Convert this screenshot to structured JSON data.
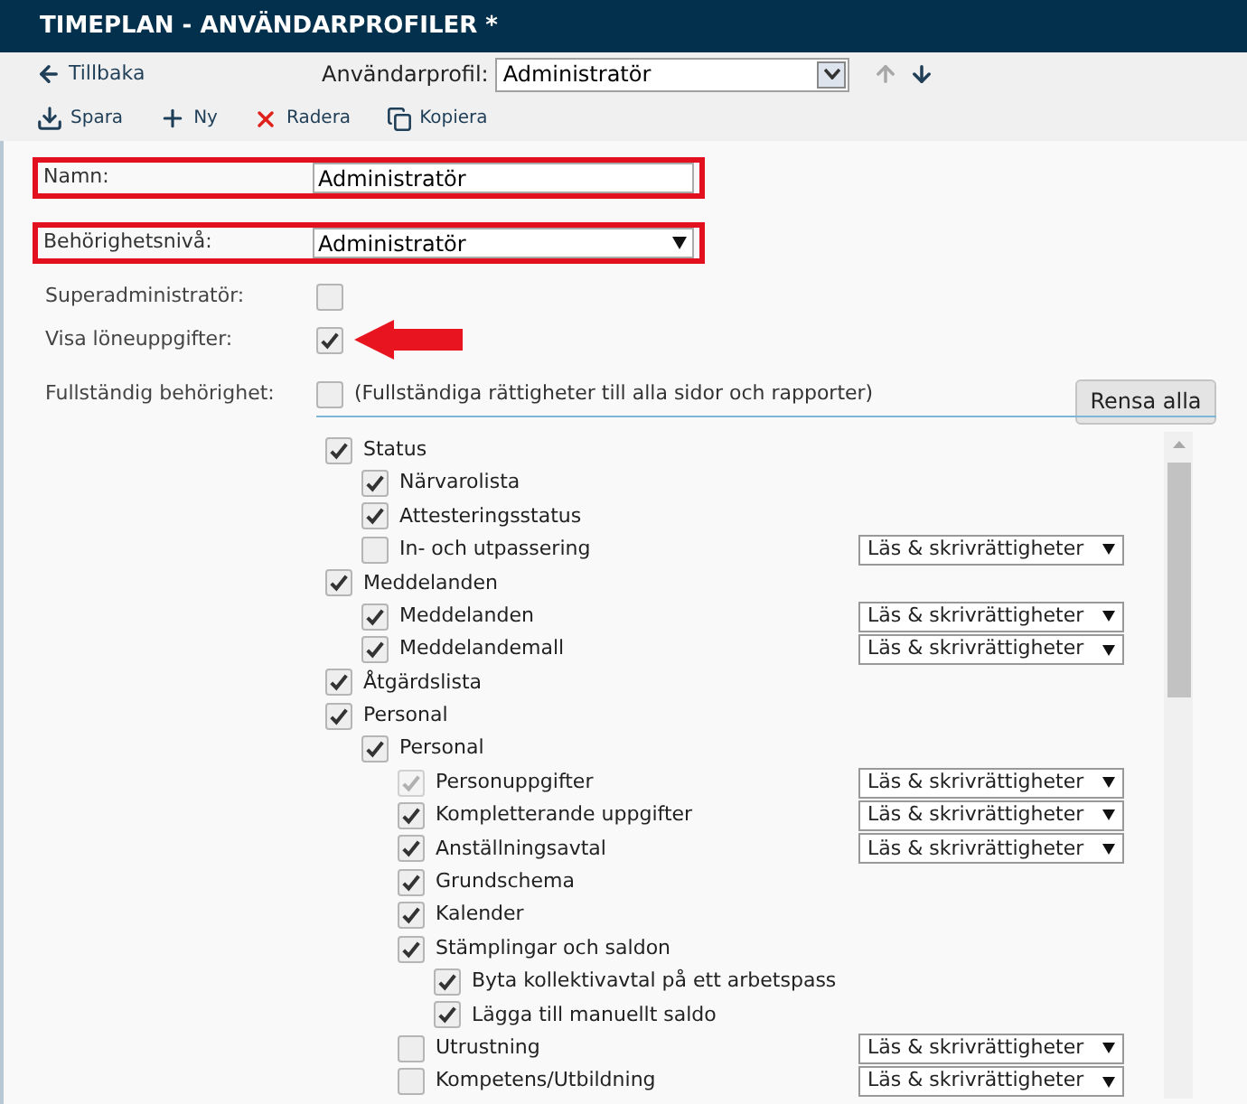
{
  "window": {
    "title": "TIMEPLAN - ANVÄNDARPROFILER *"
  },
  "nav": {
    "back": "Tillbaka",
    "profile_label": "Användarprofil:",
    "profile_value": "Administratör",
    "move_up_disabled": true,
    "move_down_disabled": false
  },
  "toolbar": [
    {
      "kind": "save",
      "label": "Spara"
    },
    {
      "kind": "new",
      "label": "Ny"
    },
    {
      "kind": "delete",
      "label": "Radera"
    },
    {
      "kind": "copy",
      "label": "Kopiera"
    }
  ],
  "form": {
    "name": {
      "label": "Namn:",
      "value": "Administratör",
      "highlighted": true
    },
    "level": {
      "label": "Behörighetsnivå:",
      "value": "Administratör",
      "highlighted": true
    },
    "superadmin": {
      "label": "Superadministratör:",
      "checked": false,
      "pointer_arrow": false
    },
    "show_salary": {
      "label": "Visa löneuppgifter:",
      "checked": true,
      "pointer_arrow": true
    },
    "full_access": {
      "label": "Fullständig behörighet:",
      "checked": false,
      "note": "(Fullständiga rättigheter till alla sidor och rapporter)"
    },
    "clear_button": "Rensa alla"
  },
  "tree": [
    {
      "label": "Status",
      "checked": true,
      "disabled": false,
      "children": [
        {
          "label": "Närvarolista",
          "checked": true,
          "disabled": false
        },
        {
          "label": "Attesteringsstatus",
          "checked": true,
          "disabled": false
        },
        {
          "label": "In- och utpassering",
          "checked": false,
          "disabled": false,
          "permission": "Läs & skrivrättigheter"
        }
      ]
    },
    {
      "label": "Meddelanden",
      "checked": true,
      "disabled": false,
      "children": [
        {
          "label": "Meddelanden",
          "checked": true,
          "disabled": false,
          "permission": "Läs & skrivrättigheter"
        },
        {
          "label": "Meddelandemall",
          "checked": true,
          "disabled": false,
          "permission": "Läs & skrivrättigheter"
        }
      ]
    },
    {
      "label": "Åtgärdslista",
      "checked": true,
      "disabled": false
    },
    {
      "label": "Personal",
      "checked": true,
      "disabled": false,
      "children": [
        {
          "label": "Personal",
          "checked": true,
          "disabled": false,
          "children": [
            {
              "label": "Personuppgifter",
              "checked": true,
              "disabled": true,
              "permission": "Läs & skrivrättigheter"
            },
            {
              "label": "Kompletterande uppgifter",
              "checked": true,
              "disabled": false,
              "permission": "Läs & skrivrättigheter"
            },
            {
              "label": "Anställningsavtal",
              "checked": true,
              "disabled": false,
              "permission": "Läs & skrivrättigheter"
            },
            {
              "label": "Grundschema",
              "checked": true,
              "disabled": false
            },
            {
              "label": "Kalender",
              "checked": true,
              "disabled": false
            },
            {
              "label": "Stämplingar och saldon",
              "checked": true,
              "disabled": false,
              "children": [
                {
                  "label": "Byta kollektivavtal på ett arbetspass",
                  "checked": true,
                  "disabled": false
                },
                {
                  "label": "Lägga till manuellt saldo",
                  "checked": true,
                  "disabled": false
                }
              ]
            },
            {
              "label": "Utrustning",
              "checked": false,
              "disabled": false,
              "permission": "Läs & skrivrättigheter"
            },
            {
              "label": "Kompetens/Utbildning",
              "checked": false,
              "disabled": false,
              "permission": "Läs & skrivrättigheter"
            }
          ]
        }
      ]
    }
  ]
}
